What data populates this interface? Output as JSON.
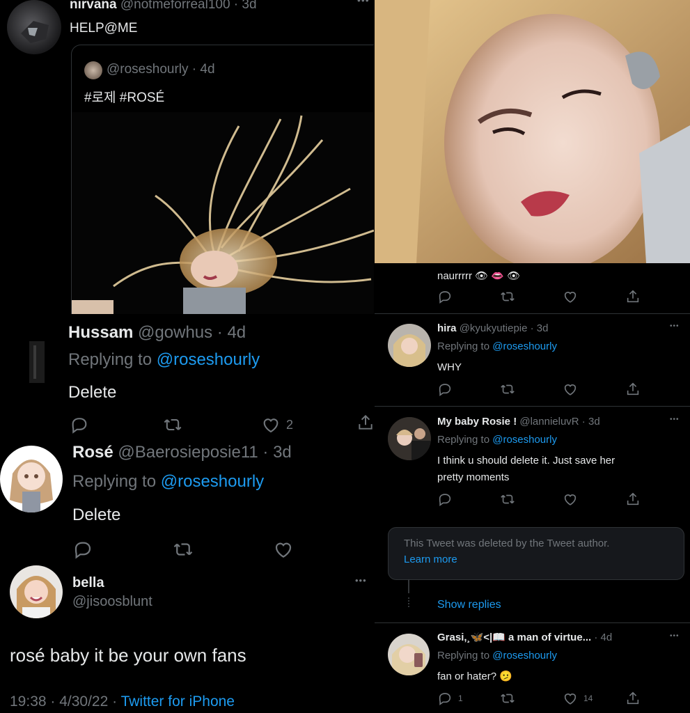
{
  "left": {
    "tweet1": {
      "name": "nirvana",
      "handle_time": "@notmeforreal100 · 3d",
      "text": "HELP@ME",
      "quote": {
        "handle_time": "@roseshourly · 4d",
        "text": "#로제 #ROSÉ"
      }
    },
    "reply1": {
      "name": "Hussam",
      "handle_time": "@gowhus · 4d",
      "replying_prefix": "Replying to",
      "replying_handle": "@roseshourly",
      "text": "Delete",
      "like_count": "2"
    },
    "reply2": {
      "name": "Rosé",
      "handle_time": "@Baerosieposie11 · 3d",
      "replying_prefix": "Replying to",
      "replying_handle": "@roseshourly",
      "text": "Delete"
    },
    "tweet2": {
      "name": "bella",
      "handle": "@jisoosblunt",
      "text": "rosé baby it be your own fans",
      "meta_time": "19:38 · 4/30/22 ·",
      "meta_source": "Twitter for iPhone"
    }
  },
  "right": {
    "r0": {
      "text": "naurrrrr 👁 👄 👁"
    },
    "r1": {
      "name": "hira",
      "handle_time": "@kyukyutiepie · 3d",
      "replying_prefix": "Replying to",
      "replying_handle": "@roseshourly",
      "text": "WHY"
    },
    "r2": {
      "name": "My baby Rosie !",
      "handle_time": "@lannieluvR · 3d",
      "replying_prefix": "Replying to",
      "replying_handle": "@roseshourly",
      "text_line1": "I think u should delete it. Just save her",
      "text_line2": "pretty moments"
    },
    "deleted": {
      "text": "This Tweet was deleted by the Tweet author.",
      "link": "Learn more"
    },
    "show_replies": "Show replies",
    "r3": {
      "name": "Grasi,¸🦋<|📖 a man of virtue...",
      "handle_time": "· 4d",
      "replying_prefix": "Replying to",
      "replying_handle": "@roseshourly",
      "text": "fan or hater? 🫤",
      "reply_count": "1",
      "like_count": "14"
    }
  },
  "colors": {
    "background": "#000000",
    "text": "#e7e9ea",
    "muted": "#71767b",
    "link": "#1d9bf0",
    "divider": "#2f3336"
  }
}
